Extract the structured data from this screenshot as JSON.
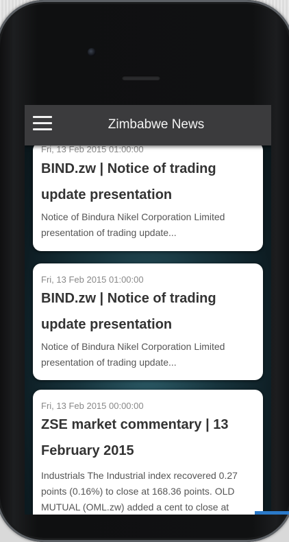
{
  "app": {
    "title": "Zimbabwe News"
  },
  "articles": [
    {
      "date": "Fri, 13 Feb 2015 01:00:00",
      "headline": "BIND.zw | Notice of trading update presentation",
      "summary": "Notice of Bindura Nikel Corporation Limited presentation of trading update..."
    },
    {
      "date": "Fri, 13 Feb 2015 01:00:00",
      "headline": "BIND.zw | Notice of trading update presentation",
      "summary": "Notice of Bindura Nikel Corporation Limited presentation of trading update..."
    },
    {
      "date": "Fri, 13 Feb 2015 00:00:00",
      "headline": "ZSE market commentary | 13 February 2015",
      "summary": "Industrials The Industrial index recovered 0.27 points (0.16%) to close at 168.36 points. OLD MUTUAL (OML.zw) added a cent to close at"
    }
  ],
  "colors": {
    "appbar": "#3b3b3d",
    "card": "#ffffff",
    "headline": "#333333"
  }
}
